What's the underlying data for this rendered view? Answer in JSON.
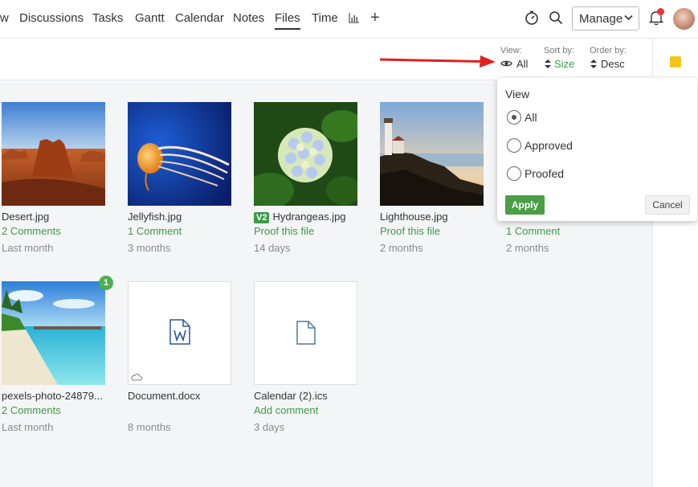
{
  "nav": {
    "tabs": [
      {
        "label": "w"
      },
      {
        "label": "Discussions"
      },
      {
        "label": "Tasks"
      },
      {
        "label": "Gantt"
      },
      {
        "label": "Calendar"
      },
      {
        "label": "Notes"
      },
      {
        "label": "Files",
        "active": true
      },
      {
        "label": "Time"
      }
    ],
    "add_label": "+",
    "manage_label": "Manage"
  },
  "filters": {
    "view": {
      "label": "View:",
      "value": "All"
    },
    "sort": {
      "label": "Sort by:",
      "value": "Size"
    },
    "order": {
      "label": "Order by:",
      "value": "Desc"
    }
  },
  "dropdown": {
    "title": "View",
    "options": [
      {
        "label": "All",
        "checked": true
      },
      {
        "label": "Approved",
        "checked": false
      },
      {
        "label": "Proofed",
        "checked": false
      }
    ],
    "apply_label": "Apply",
    "cancel_label": "Cancel"
  },
  "files": [
    {
      "name": "Desert.jpg",
      "meta": "2 Comments",
      "time": "Last month"
    },
    {
      "name": "Jellyfish.jpg",
      "meta": "1 Comment",
      "time": "3 months"
    },
    {
      "name": "Hydrangeas.jpg",
      "version": "V2",
      "meta": "Proof this file",
      "time": "14 days"
    },
    {
      "name": "Lighthouse.jpg",
      "meta": "Proof this file",
      "time": "2 months"
    },
    {
      "name": "",
      "meta": "1 Comment",
      "time": "2 months"
    },
    {
      "name": "pexels-photo-24879...",
      "meta": "2 Comments",
      "time": "Last month",
      "badge": "1"
    },
    {
      "name": "Document.docx",
      "meta": "",
      "time": "8 months"
    },
    {
      "name": "Calendar (2).ics",
      "meta": "Add comment",
      "time": "3 days"
    }
  ],
  "colors": {
    "accent_green": "#3d9a46",
    "arrow_red": "#e02020",
    "notification_red": "#e53935"
  }
}
